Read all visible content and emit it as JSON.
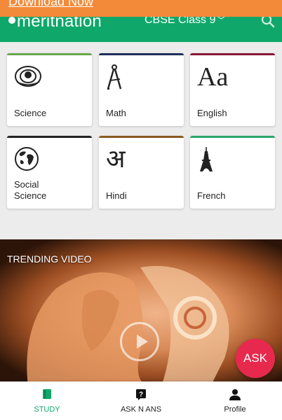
{
  "banner": {
    "download_label": "Download Now",
    "color": "#f38a3a"
  },
  "header": {
    "brand": "meritnation",
    "class_label": "CBSE Class 9",
    "color": "#0fa86a"
  },
  "subjects": [
    {
      "label": "Science",
      "icon": "atom-icon",
      "color": "#6aa84f"
    },
    {
      "label": "Math",
      "icon": "compass-icon",
      "color": "#1f2f5a"
    },
    {
      "label": "English",
      "icon": "aa-letters-icon",
      "glyph": "Aa",
      "color": "#8a1538"
    },
    {
      "label": "Social\nScience",
      "icon": "globe-icon",
      "color": "#222222"
    },
    {
      "label": "Hindi",
      "icon": "hindi-letter-icon",
      "glyph": "अ",
      "color": "#8a5a20"
    },
    {
      "label": "French",
      "icon": "eiffel-tower-icon",
      "color": "#2ca86a"
    }
  ],
  "video": {
    "section_title": "TRENDING VIDEO"
  },
  "fab": {
    "label": "ASK",
    "color": "#e8294e"
  },
  "bottom_nav": [
    {
      "label": "STUDY",
      "icon": "book-icon",
      "active": true
    },
    {
      "label": "ASK N ANS",
      "icon": "question-icon",
      "active": false
    },
    {
      "label": "Profile",
      "icon": "person-icon",
      "active": false
    }
  ]
}
